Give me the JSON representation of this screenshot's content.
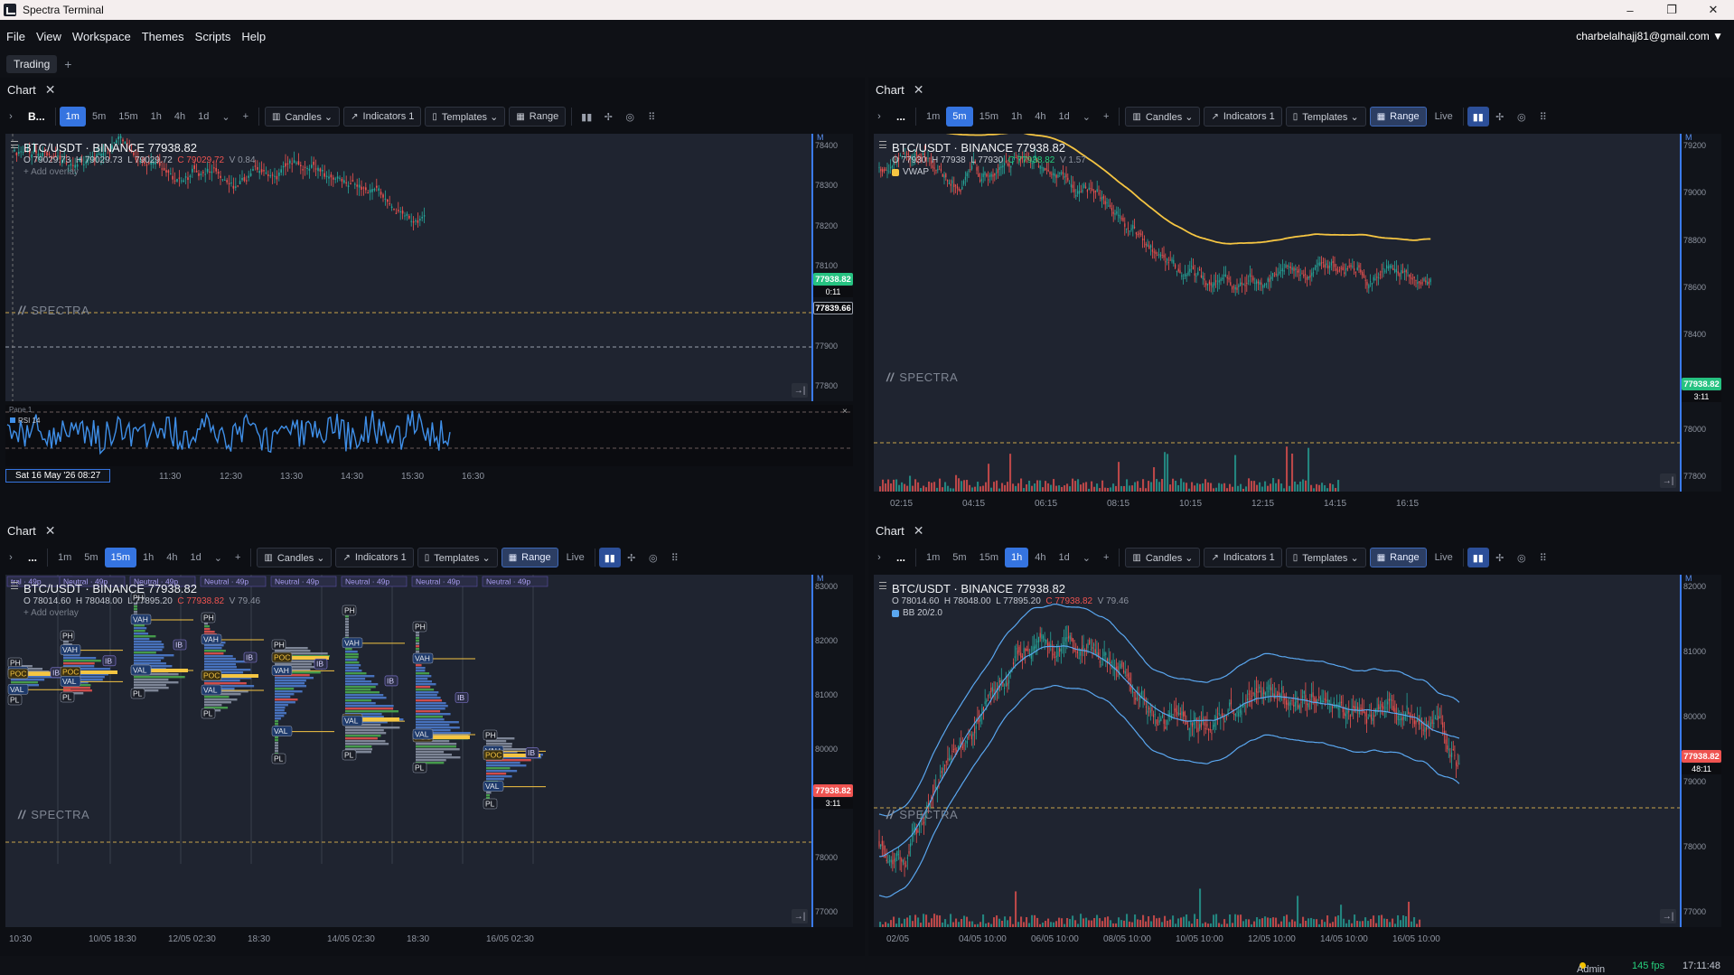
{
  "window": {
    "title": "Spectra Terminal",
    "controls": [
      "–",
      "❐",
      "✕"
    ]
  },
  "menu": [
    "File",
    "View",
    "Workspace",
    "Themes",
    "Scripts",
    "Help"
  ],
  "account": "charbelalhajj81@gmail.com ▼",
  "workspace": {
    "tab": "Trading",
    "add": "+"
  },
  "common": {
    "chart_title": "Chart",
    "close": "✕",
    "expand": "›",
    "timeframes": [
      "1m",
      "5m",
      "15m",
      "1h",
      "4h",
      "1d"
    ],
    "more_tf": "⌄",
    "add": "+",
    "candles": "Candles ⌄",
    "indicators": "Indicators 1",
    "templates": "Templates ⌄",
    "range": "Range",
    "live": "Live",
    "watermark": "SPECTRA",
    "add_overlay": "+ Add overlay",
    "symbol": "BTC/USDT · BINANCE  77938.82",
    "scroll_end": "→|",
    "price_axis_mode": "M"
  },
  "panels": [
    {
      "symbol_btn": "B...",
      "active_tf": "1m",
      "ohlc": {
        "o": "O 79029.73",
        "h": "H 79029.73",
        "l": "L 79029.72",
        "c": "C 79029.72",
        "v": "V 0.84"
      },
      "indicator": "",
      "price_ticks": [
        "78400",
        "78300",
        "78200",
        "78100",
        "78000",
        "77900",
        "77800"
      ],
      "tag": "77938.82",
      "tag_color": "#26c281",
      "countdown": "0:11",
      "tag2": "77839.66",
      "time_ticks": [
        "11:30",
        "12:30",
        "13:30",
        "14:30",
        "15:30",
        "16:30"
      ],
      "date_chip": "Sat 16 May '26 08:27",
      "rsi_title": "Pane 1",
      "rsi_label": "RSI 14"
    },
    {
      "symbol_btn": "...",
      "active_tf": "5m",
      "ohlc": {
        "o": "O 77930",
        "h": "H 77938",
        "l": "L 77930",
        "c": "C 77938.82",
        "v": "V 1.57"
      },
      "indicator": "VWAP",
      "price_ticks": [
        "79200",
        "79000",
        "78800",
        "78600",
        "78400",
        "78200",
        "78000",
        "77800"
      ],
      "tag": "77938.82",
      "tag_color": "#26c281",
      "countdown": "3:11",
      "time_ticks": [
        "02:15",
        "04:15",
        "06:15",
        "08:15",
        "10:15",
        "12:15",
        "14:15",
        "16:15"
      ]
    },
    {
      "symbol_btn": "...",
      "active_tf": "15m",
      "ohlc": {
        "o": "O 78014.60",
        "h": "H 78048.00",
        "l": "L 77895.20",
        "c": "C 77938.82",
        "v": "V 79.46"
      },
      "indicator": "",
      "price_ticks": [
        "83000",
        "82000",
        "81000",
        "80000",
        "79000",
        "78000",
        "77000"
      ],
      "tag": "77938.82",
      "tag_color": "#ef5350",
      "countdown": "3:11",
      "time_ticks": [
        "10:30",
        "10/05 18:30",
        "12/05 02:30",
        "18:30",
        "14/05 02:30",
        "18:30",
        "16/05 02:30"
      ],
      "session_label": "Neutral · 49p",
      "session_label_first": "tral · 49p",
      "profile_labels": {
        "ph": "PH",
        "vah": "VAH",
        "poc": "POC",
        "val": "VAL",
        "pl": "PL",
        "ib": "IB"
      }
    },
    {
      "symbol_btn": "...",
      "active_tf": "1h",
      "ohlc": {
        "o": "O 78014.60",
        "h": "H 78048.00",
        "l": "L 77895.20",
        "c": "C 77938.82",
        "v": "V 79.46"
      },
      "indicator": "BB 20/2.0",
      "price_ticks": [
        "82000",
        "81000",
        "80000",
        "79000",
        "78000",
        "77000"
      ],
      "tag": "77938.82",
      "tag_color": "#ef5350",
      "countdown": "48:11",
      "time_ticks": [
        "02/05",
        "04/05 10:00",
        "06/05 10:00",
        "08/05 10:00",
        "10/05 10:00",
        "12/05 10:00",
        "14/05 10:00",
        "16/05 10:00"
      ]
    }
  ],
  "status": {
    "user": "Admin",
    "fps": "145 fps",
    "time": "17:11:48"
  }
}
